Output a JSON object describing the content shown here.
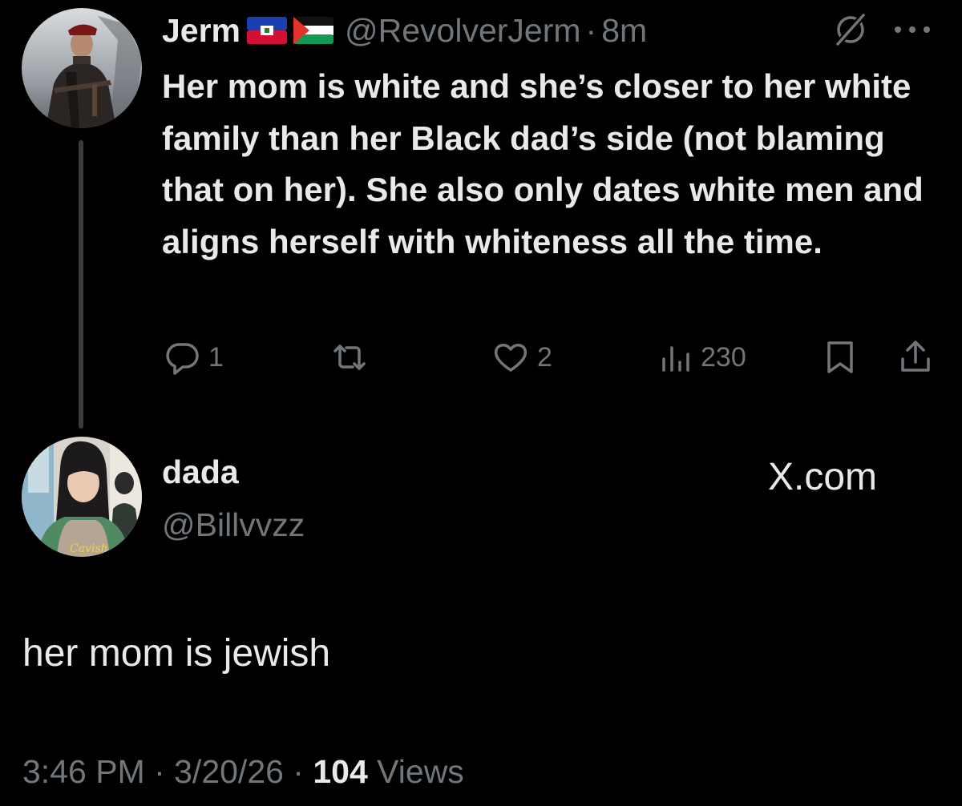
{
  "reply": {
    "author": {
      "display_name": "Jerm",
      "flags": [
        "haiti-flag",
        "palestine-flag"
      ],
      "handle": "@RevolverJerm",
      "separator": "·",
      "time": "8m"
    },
    "text": "Her mom is white and she’s closer to her white family than her Black dad’s side (not blaming that on her). She also only dates white men and aligns herself with whiteness all the time.",
    "stats": {
      "replies": "1",
      "reposts": "",
      "likes": "2",
      "views": "230"
    },
    "icons": [
      "grok-icon",
      "more-icon",
      "reply-icon",
      "retweet-icon",
      "heart-icon",
      "views-icon",
      "bookmark-icon",
      "share-icon"
    ]
  },
  "original": {
    "author": {
      "display_name": "dada",
      "handle": "@Billvvzz"
    },
    "watermark": "X.com",
    "text": "her mom is jewish",
    "timestamp": "3:46 PM · 3/20/26 · ",
    "views_count": "104",
    "views_label": " Views"
  },
  "colors": {
    "background": "#000000",
    "primary_text": "#e7e9ea",
    "secondary_text": "#71767b",
    "thread_line": "#3a3d40"
  }
}
